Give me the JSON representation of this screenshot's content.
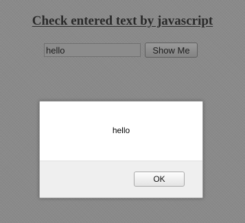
{
  "page": {
    "heading": "Check entered text by javascript"
  },
  "form": {
    "input_value": "hello",
    "button_label": "Show Me"
  },
  "alert": {
    "message": "hello",
    "ok_label": "OK"
  }
}
